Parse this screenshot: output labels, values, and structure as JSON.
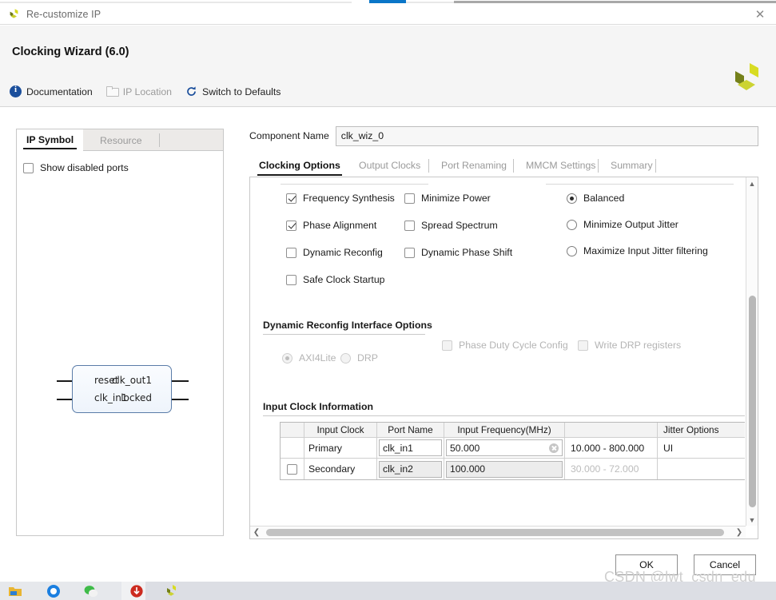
{
  "window": {
    "title": "Re-customize IP",
    "close_label": "✕",
    "logo_name": "xilinx-logo"
  },
  "header": {
    "title": "Clocking Wizard (6.0)",
    "toolbar": [
      {
        "label": "Documentation",
        "icon": "info-icon",
        "disabled": false
      },
      {
        "label": "IP Location",
        "icon": "folder-icon",
        "disabled": true
      },
      {
        "label": "Switch to Defaults",
        "icon": "refresh-icon",
        "disabled": false
      }
    ]
  },
  "left_panel": {
    "tabs": [
      {
        "label": "IP Symbol",
        "active": true
      },
      {
        "label": "Resource",
        "active": false
      }
    ],
    "show_disabled_ports": {
      "label": "Show disabled ports",
      "checked": false
    },
    "symbol": {
      "left_ports": [
        "reset",
        "clk_in1"
      ],
      "right_ports": [
        "clk_out1",
        "locked"
      ]
    }
  },
  "component": {
    "label": "Component Name",
    "value": "clk_wiz_0"
  },
  "tabs": [
    {
      "label": "Clocking Options",
      "active": true
    },
    {
      "label": "Output Clocks",
      "active": false
    },
    {
      "label": "Port Renaming",
      "active": false
    },
    {
      "label": "MMCM Settings",
      "active": false
    },
    {
      "label": "Summary",
      "active": false
    }
  ],
  "clocking_options": {
    "checkboxes_col1": [
      {
        "label": "Frequency Synthesis",
        "checked": true,
        "disabled": false
      },
      {
        "label": "Phase Alignment",
        "checked": true,
        "disabled": false
      },
      {
        "label": "Dynamic Reconfig",
        "checked": false,
        "disabled": false
      },
      {
        "label": "Safe Clock Startup",
        "checked": false,
        "disabled": false
      }
    ],
    "checkboxes_col2": [
      {
        "label": "Minimize Power",
        "checked": false,
        "disabled": false
      },
      {
        "label": "Spread Spectrum",
        "checked": false,
        "disabled": false
      },
      {
        "label": "Dynamic Phase Shift",
        "checked": false,
        "disabled": false
      }
    ],
    "jitter_radios": [
      {
        "label": "Balanced",
        "checked": true
      },
      {
        "label": "Minimize Output Jitter",
        "checked": false
      },
      {
        "label": "Maximize Input Jitter filtering",
        "checked": false
      }
    ]
  },
  "dynamic_reconfig": {
    "title": "Dynamic Reconfig Interface Options",
    "radios": [
      {
        "label": "AXI4Lite",
        "checked": true,
        "disabled": true
      },
      {
        "label": "DRP",
        "checked": false,
        "disabled": true
      }
    ],
    "checkboxes": [
      {
        "label": "Phase Duty Cycle Config",
        "checked": false,
        "disabled": true
      },
      {
        "label": "Write DRP registers",
        "checked": false,
        "disabled": true
      }
    ]
  },
  "input_clock_information": {
    "title": "Input Clock Information",
    "columns": [
      "",
      "Input Clock",
      "Port Name",
      "Input Frequency(MHz)",
      "",
      "Jitter Options"
    ],
    "rows": [
      {
        "enabled": null,
        "input_clock": "Primary",
        "port_name": "clk_in1",
        "frequency": "50.000",
        "has_clear": true,
        "range": "10.000 - 800.000",
        "range_disabled": false,
        "jitter_options": "UI",
        "readonly": false
      },
      {
        "enabled": false,
        "input_clock": "Secondary",
        "port_name": "clk_in2",
        "frequency": "100.000",
        "has_clear": false,
        "range": "30.000 - 72.000",
        "range_disabled": true,
        "jitter_options": "",
        "readonly": true
      }
    ]
  },
  "footer": {
    "ok_label": "OK",
    "cancel_label": "Cancel"
  },
  "watermark": "CSDN @lwt_csdn_edu",
  "taskbar": {
    "icons": [
      "folder-icon",
      "browser-icon",
      "wechat-icon",
      "pdf-icon",
      "vivado-icon"
    ]
  }
}
